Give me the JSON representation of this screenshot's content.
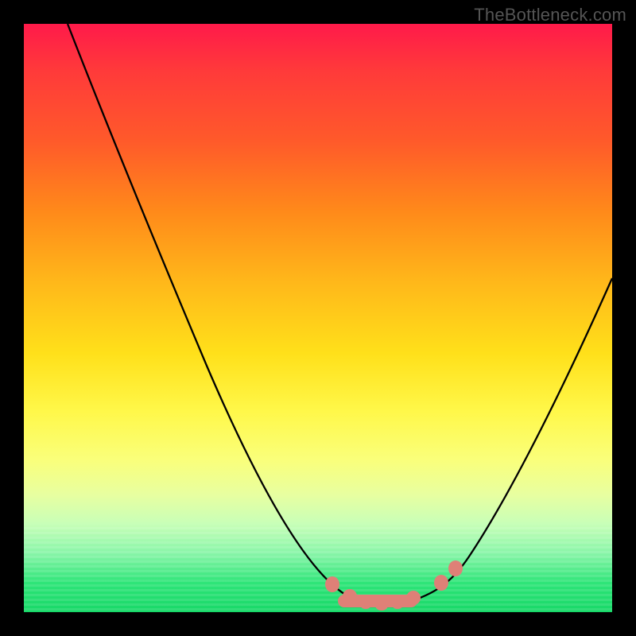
{
  "watermark": "TheBottleneck.com",
  "chart_data": {
    "type": "line",
    "title": "",
    "xlabel": "",
    "ylabel": "",
    "xlim": [
      0,
      100
    ],
    "ylim": [
      0,
      100
    ],
    "series": [
      {
        "name": "bottleneck-curve",
        "x": [
          8,
          12,
          18,
          24,
          30,
          36,
          42,
          48,
          53,
          57,
          60,
          63,
          66,
          70,
          74,
          78,
          82,
          86,
          90,
          94,
          100
        ],
        "y": [
          100,
          90,
          77,
          64,
          51,
          38,
          26,
          14,
          6,
          2,
          1,
          1,
          2,
          4,
          8,
          14,
          22,
          31,
          40,
          48,
          58
        ]
      }
    ],
    "markers": [
      {
        "name": "pink-blob-left-edge",
        "x": 53,
        "y": 4
      },
      {
        "name": "pink-blob-flat-1",
        "x": 57,
        "y": 2
      },
      {
        "name": "pink-blob-flat-2",
        "x": 60,
        "y": 1
      },
      {
        "name": "pink-blob-flat-3",
        "x": 63,
        "y": 1
      },
      {
        "name": "pink-blob-flat-4",
        "x": 66,
        "y": 2
      },
      {
        "name": "pink-blob-right-lower",
        "x": 71,
        "y": 5
      },
      {
        "name": "pink-blob-right-upper",
        "x": 73,
        "y": 8
      }
    ],
    "background_gradient": {
      "top": "#ff1a4a",
      "mid": "#ffe01a",
      "bottom": "#18d868"
    }
  }
}
